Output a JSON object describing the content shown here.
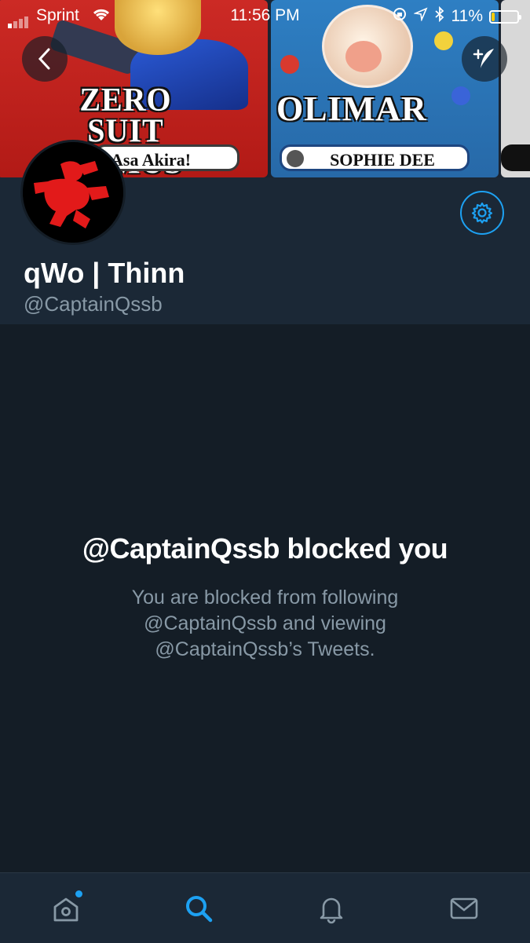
{
  "status_bar": {
    "carrier": "Sprint",
    "time": "11:56 PM",
    "battery_percent": "11%",
    "battery_level": 0.11,
    "icons": [
      "signal-icon",
      "wifi-icon",
      "rotation-lock-icon",
      "location-icon",
      "bluetooth-icon",
      "battery-icon"
    ]
  },
  "header": {
    "card1_name": "ZERO SUIT SAMUS",
    "card1_tag": "Asa Akira!",
    "card2_name": "OLIMAR",
    "card2_tag": "SOPHIE DEE"
  },
  "nav": {
    "back_icon": "chevron-left-icon",
    "compose_icon": "compose-tweet-icon",
    "settings_icon": "gear-icon"
  },
  "profile": {
    "display_name": "qWo | Thinn",
    "handle": "@CaptainQssb"
  },
  "blocked": {
    "title": "@CaptainQssb blocked you",
    "description": "You are blocked from following @CaptainQssb and viewing @CaptainQssb’s Tweets."
  },
  "tabbar": {
    "tabs": [
      {
        "icon": "home-icon",
        "active": false,
        "has_badge": true
      },
      {
        "icon": "search-icon",
        "active": true
      },
      {
        "icon": "notifications-icon",
        "active": false
      },
      {
        "icon": "messages-icon",
        "active": false
      }
    ]
  },
  "colors": {
    "accent": "#1da1f2",
    "background": "#141d26",
    "panel": "#1b2836",
    "secondary_text": "#8899a6"
  }
}
